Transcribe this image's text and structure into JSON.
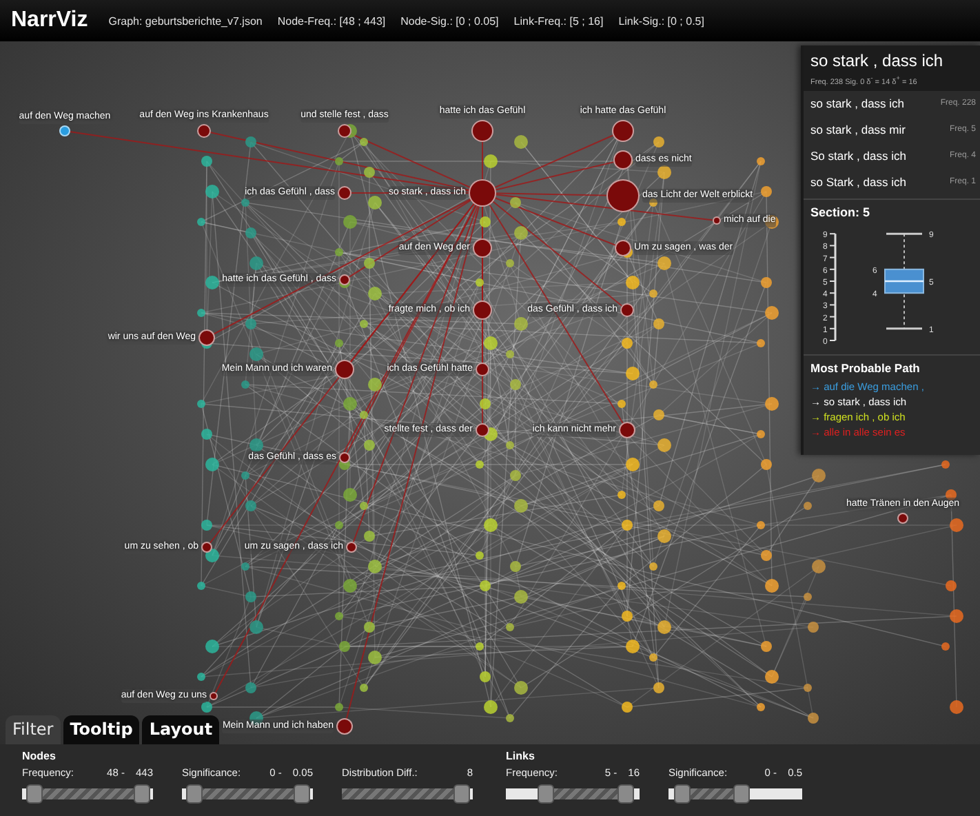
{
  "header": {
    "title": "NarrViz",
    "info": [
      "Graph: geburtsberichte_v7.json",
      "Node-Freq.: [48 ; 443]",
      "Node-Sig.: [0 ; 0.05]",
      "Link-Freq.: [5 ; 16]",
      "Link-Sig.: [0 ; 0.5]"
    ]
  },
  "graph": {
    "nodes": [
      {
        "label": "auf den Weg machen",
        "color": "#2a9de0"
      },
      {
        "label": "auf den Weg ins Krankenhaus",
        "color": "#7a0a0a"
      },
      {
        "label": "und stelle fest , dass",
        "color": "#7a0a0a"
      },
      {
        "label": "hatte ich das Gefühl",
        "color": "#7a0a0a"
      },
      {
        "label": "ich hatte das Gefühl",
        "color": "#7a0a0a"
      },
      {
        "label": "dass es nicht",
        "color": "#7a0a0a"
      },
      {
        "label": "ich das Gefühl , dass",
        "color": "#7a0a0a"
      },
      {
        "label": "so stark , dass ich",
        "color": "#7a0a0a"
      },
      {
        "label": "das Licht der Welt erblickt",
        "color": "#7a0a0a"
      },
      {
        "label": "mich auf die",
        "color": "#7a0a0a"
      },
      {
        "label": "auf den Weg der",
        "color": "#7a0a0a"
      },
      {
        "label": "Um zu sagen , was der",
        "color": "#7a0a0a"
      },
      {
        "label": "hatte ich das Gefühl , dass",
        "color": "#7a0a0a"
      },
      {
        "label": "fragte mich , ob ich",
        "color": "#7a0a0a"
      },
      {
        "label": "das Gefühl , dass ich",
        "color": "#7a0a0a"
      },
      {
        "label": "wir uns auf den Weg",
        "color": "#7a0a0a"
      },
      {
        "label": "Mein Mann und ich waren",
        "color": "#7a0a0a"
      },
      {
        "label": "ich das Gefühl hatte",
        "color": "#7a0a0a"
      },
      {
        "label": "stellte fest , dass der",
        "color": "#7a0a0a"
      },
      {
        "label": "ich kann nicht mehr",
        "color": "#7a0a0a"
      },
      {
        "label": "das Gefühl , dass es",
        "color": "#7a0a0a"
      },
      {
        "label": "hatte Tränen in den Augen",
        "color": "#7a0a0a"
      },
      {
        "label": "um zu sehen , ob",
        "color": "#7a0a0a"
      },
      {
        "label": "um zu sagen , dass ich",
        "color": "#7a0a0a"
      },
      {
        "label": "auf den Weg zu uns",
        "color": "#7a0a0a"
      },
      {
        "label": "Mein Mann und ich haben",
        "color": "#7a0a0a"
      }
    ]
  },
  "tooltip": {
    "title": "so stark , dass ich",
    "meta": "Freq. 238   Sig. 0   δ$^{-}$ = 14   δ$^{+}$ = 16",
    "variants": [
      {
        "phrase": "so stark , dass ich",
        "freq": "Freq. 228"
      },
      {
        "phrase": "so stark , dass mir",
        "freq": "Freq. 5"
      },
      {
        "phrase": "So stark , dass ich",
        "freq": "Freq. 4"
      },
      {
        "phrase": "so Stark , dass ich",
        "freq": "Freq. 1"
      }
    ],
    "section": {
      "label": "Section: 5",
      "boxplot": {
        "ticks": [
          "9",
          "8",
          "7",
          "6",
          "5",
          "4",
          "3",
          "2",
          "1",
          "0"
        ],
        "max": "9",
        "q3": "6",
        "median": "5",
        "q1": "4",
        "min": "1"
      }
    },
    "path": {
      "title": "Most Probable Path",
      "items": [
        {
          "text": "→ auf die Weg machen ,",
          "color": "#3a9ee0"
        },
        {
          "text": "→ so stark , dass ich",
          "color": "#ffffff"
        },
        {
          "text": "→ fragen ich , ob ich",
          "color": "#cfe020"
        },
        {
          "text": "→ alle in alle sein es",
          "color": "#e02020"
        }
      ]
    }
  },
  "tabs": [
    {
      "label": "Filter",
      "selected": true
    },
    {
      "label": "Tooltip",
      "selected": false
    },
    {
      "label": "Layout",
      "selected": false
    }
  ],
  "filter": {
    "groups": [
      {
        "title": "Nodes",
        "sliders": [
          {
            "label": "Frequency:",
            "low": "48 -",
            "high": "443",
            "thumbs": [
              {
                "level": 0.04
              },
              {
                "level": 0.97
              }
            ]
          },
          {
            "label": "Significance:",
            "low": "0 -",
            "high": "0.05",
            "thumbs": [
              {
                "level": 0.04
              },
              {
                "level": 0.97
              }
            ]
          },
          {
            "label": "Distribution Diff.:",
            "high": "8",
            "thumbs": [
              {
                "level": 0.97
              }
            ]
          }
        ]
      },
      {
        "title": "Links",
        "sliders": [
          {
            "label": "Frequency:",
            "low": "5 -",
            "high": "16",
            "thumbs": [
              {
                "level": 0.27
              },
              {
                "level": 0.95
              }
            ]
          },
          {
            "label": "Significance:",
            "low": "0 -",
            "high": "0.5",
            "thumbs": [
              {
                "level": 0.05
              },
              {
                "level": 0.55
              }
            ]
          }
        ]
      }
    ]
  }
}
